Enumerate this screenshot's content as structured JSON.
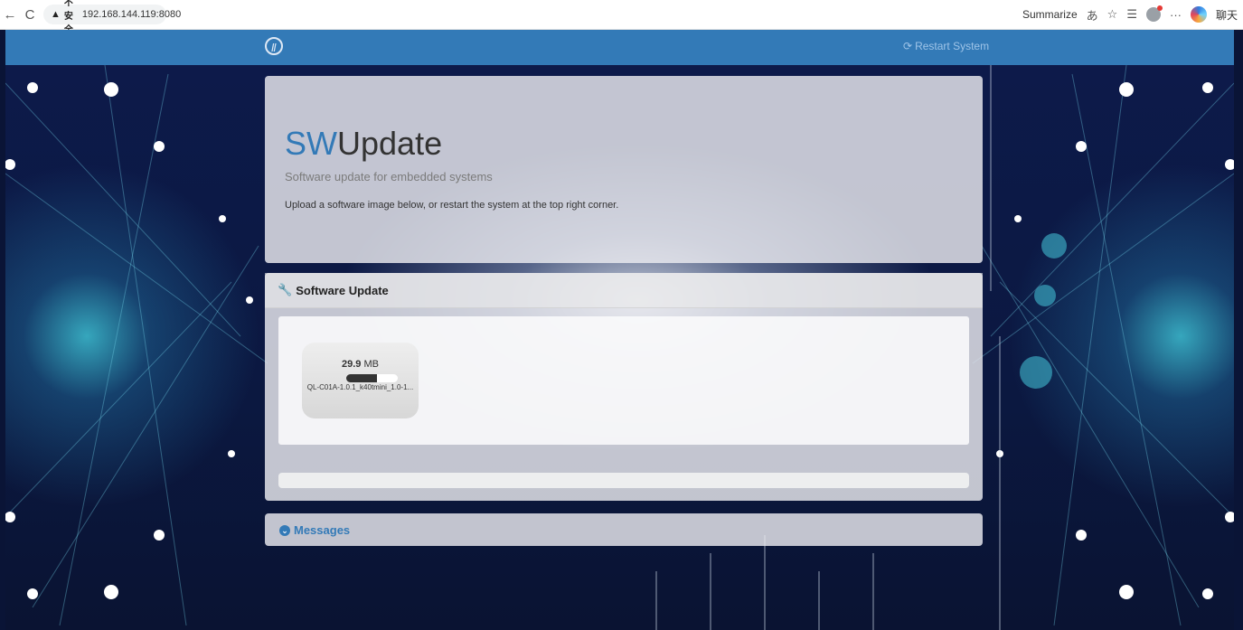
{
  "browser": {
    "back_icon": "←",
    "reload_icon": "C",
    "warning_icon": "▲",
    "insecure_label": "不安全",
    "url": "192.168.144.119:8080",
    "summarize_label": "Summarize",
    "right_label": "聊天"
  },
  "navbar": {
    "logo_glyph": "Ⅱ",
    "restart_label": "Restart System"
  },
  "jumbotron": {
    "title_sw": "SW",
    "title_rest": "Update",
    "subtitle": "Software update for embedded systems",
    "description": "Upload a software image below, or restart the system at the top right corner."
  },
  "update_panel": {
    "heading": "Software Update",
    "file": {
      "size_value": "29.9",
      "size_unit": "MB",
      "name": "QL-C01A-1.0.1_k40tmini_1.0-1...",
      "progress_fraction": 0.6
    }
  },
  "messages_panel": {
    "heading": "Messages"
  },
  "colors": {
    "accent": "#337ab7",
    "navbar": "#337ab7"
  }
}
